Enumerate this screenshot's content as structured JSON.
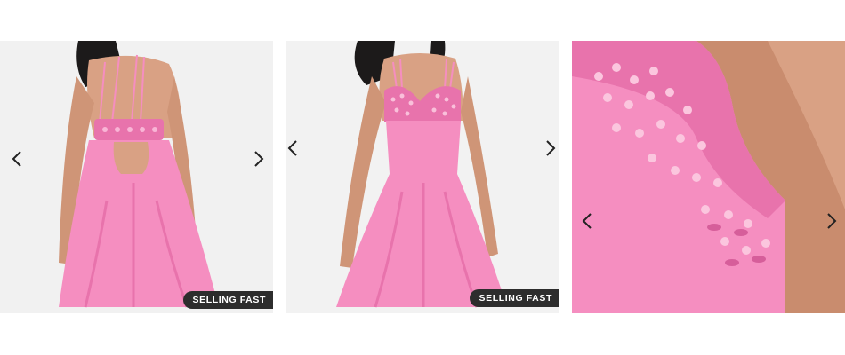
{
  "gallery": {
    "cards": [
      {
        "alt": "Pink dress, back view",
        "badge": "SELLING FAST",
        "prev_icon": "chevron-left-icon",
        "next_icon": "chevron-right-icon"
      },
      {
        "alt": "Pink dress, front view",
        "badge": "SELLING FAST",
        "prev_icon": "chevron-left-icon",
        "next_icon": "chevron-right-icon"
      },
      {
        "alt": "Pink dress, embellished bodice close-up",
        "prev_icon": "chevron-left-icon",
        "next_icon": "chevron-right-icon"
      }
    ]
  },
  "colors": {
    "dress": "#f58ec0",
    "dress_shade": "#e873ac",
    "badge_bg": "#2d2d2d",
    "background": "#f3f3f3"
  }
}
